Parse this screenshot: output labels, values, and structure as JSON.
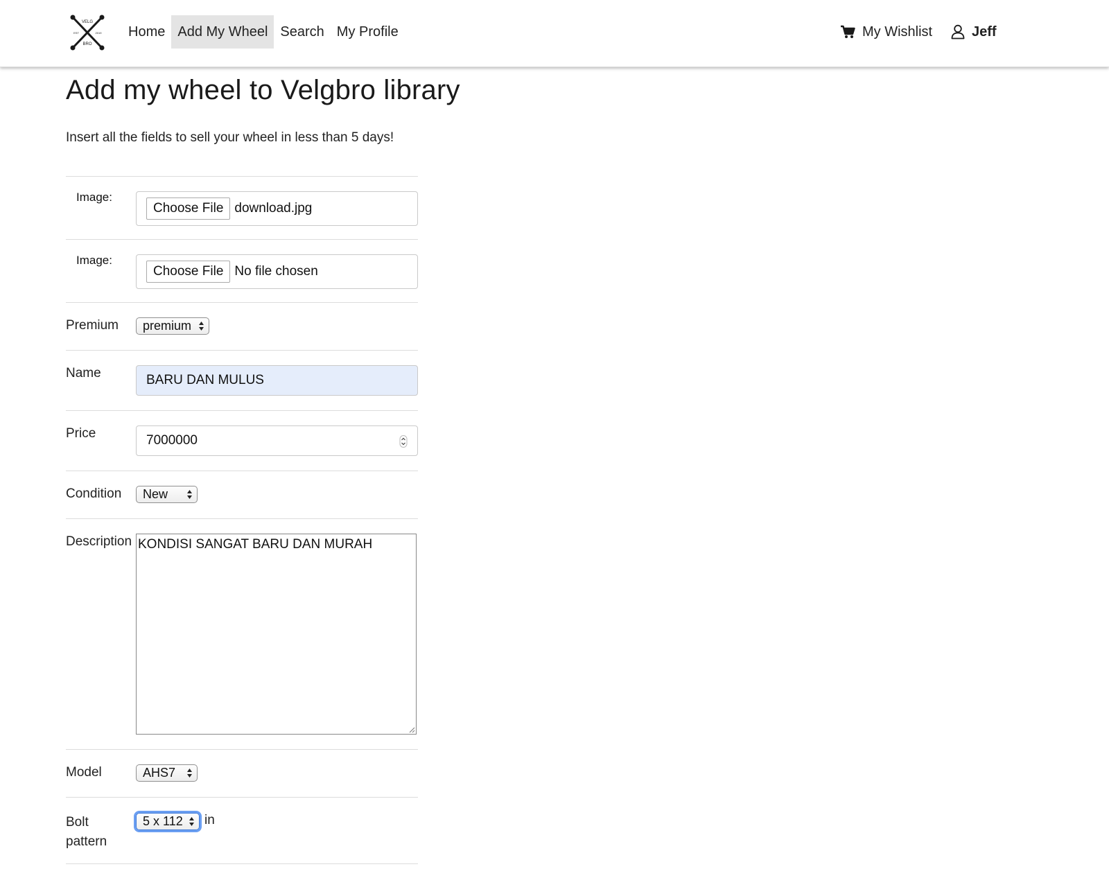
{
  "nav": {
    "logo_top": "VELG",
    "logo_left": "EST",
    "logo_right": "2019",
    "logo_bottom": "BRO",
    "links": [
      {
        "label": "Home"
      },
      {
        "label": "Add My Wheel"
      },
      {
        "label": "Search"
      },
      {
        "label": "My Profile"
      }
    ],
    "wishlist_label": "My Wishlist",
    "user_name": "Jeff"
  },
  "page": {
    "title": "Add my wheel to Velgbro library",
    "intro": "Insert all the fields to sell your wheel in less than 5 days!"
  },
  "form": {
    "image1": {
      "label": "Image:",
      "button": "Choose File",
      "value": "download.jpg"
    },
    "image2": {
      "label": "Image:",
      "button": "Choose File",
      "value": "No file chosen"
    },
    "premium": {
      "label": "Premium",
      "value": "premium"
    },
    "name": {
      "label": "Name",
      "value": "BARU DAN MULUS"
    },
    "price": {
      "label": "Price",
      "value": "7000000"
    },
    "condition": {
      "label": "Condition",
      "value": "New"
    },
    "description": {
      "label": "Description",
      "value": "KONDISI SANGAT BARU DAN MURAH"
    },
    "model": {
      "label": "Model",
      "value": "AHS7"
    },
    "bolt": {
      "label_line1": "Bolt",
      "label_line2": "pattern",
      "value": "5 x 112",
      "unit": "in"
    }
  }
}
